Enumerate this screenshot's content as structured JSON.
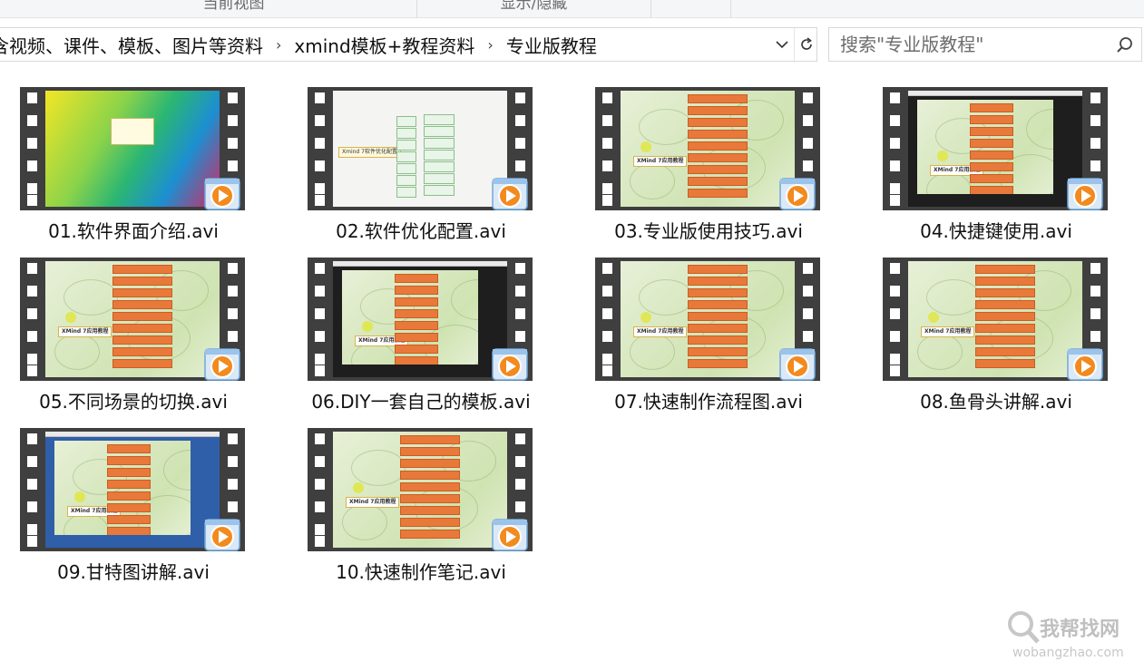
{
  "ribbon": {
    "groups": [
      "当前视图",
      "显示/隐藏"
    ]
  },
  "address_bar": {
    "breadcrumbs": [
      "视频、课件、模板、图片等资料",
      "xmind模板+教程资料",
      "专业版教程"
    ],
    "partial_first_text": "含视频、课件、模板、图片等资料",
    "separator": "›",
    "dropdown_icon": "chevron-down-icon",
    "refresh_icon": "refresh-icon"
  },
  "search": {
    "placeholder": "搜索\"专业版教程\"",
    "icon": "search-icon"
  },
  "files": [
    {
      "name": "01.软件界面介绍.avi",
      "thumb_style": "desktop"
    },
    {
      "name": "02.软件优化配置.avi",
      "thumb_style": "mindmap-light"
    },
    {
      "name": "03.专业版使用技巧.avi",
      "thumb_style": "leaves"
    },
    {
      "name": "04.快捷键使用.avi",
      "thumb_style": "window-leaves"
    },
    {
      "name": "05.不同场景的切换.avi",
      "thumb_style": "leaves"
    },
    {
      "name": "06.DIY一套自己的模板.avi",
      "thumb_style": "window-leaves"
    },
    {
      "name": "07.快速制作流程图.avi",
      "thumb_style": "leaves"
    },
    {
      "name": "08.鱼骨头讲解.avi",
      "thumb_style": "leaves"
    },
    {
      "name": "09.甘特图讲解.avi",
      "thumb_style": "window-desktop"
    },
    {
      "name": "10.快速制作笔记.avi",
      "thumb_style": "leaves"
    }
  ],
  "thumbnail_text": {
    "xmind_title": "XMind 7应用教程",
    "mindmap_title": "Xmind 7软件优化配置"
  },
  "watermark": {
    "title": "我帮找网",
    "url": "wobangzhao.com"
  },
  "colors": {
    "film": "#3f3f3f",
    "accent_orange": "#e8793a",
    "play_blue": "#4a9fe0"
  }
}
